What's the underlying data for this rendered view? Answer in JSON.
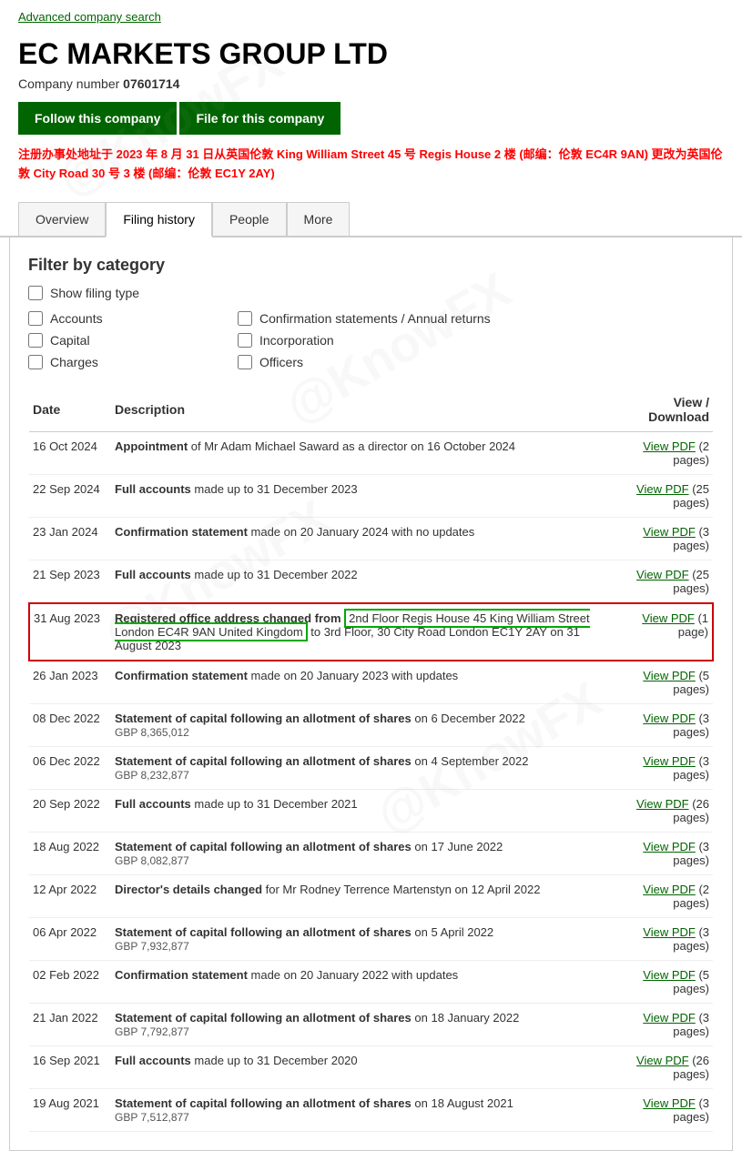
{
  "topLink": {
    "text": "Advanced company search",
    "href": "#"
  },
  "company": {
    "title": "EC MARKETS GROUP LTD",
    "numberLabel": "Company number",
    "number": "07601714"
  },
  "buttons": {
    "follow": "Follow this company",
    "file": "File for this company"
  },
  "notice": "注册办事处地址于 2023 年 8 月 31 日从英国伦敦 King William Street 45 号 Regis House 2 楼 (邮编：伦敦 EC4R 9AN) 更改为英国伦敦 City Road 30 号 3 楼 (邮编：伦敦 EC1Y 2AY)",
  "tabs": [
    {
      "label": "Overview",
      "active": false
    },
    {
      "label": "Filing history",
      "active": true
    },
    {
      "label": "People",
      "active": false
    },
    {
      "label": "More",
      "active": false
    }
  ],
  "filter": {
    "title": "Filter by category",
    "showFilingLabel": "Show filing type",
    "checkboxes": [
      {
        "label": "Accounts",
        "checked": false
      },
      {
        "label": "Confirmation statements / Annual returns",
        "checked": false
      },
      {
        "label": "Capital",
        "checked": false
      },
      {
        "label": "Incorporation",
        "checked": false
      },
      {
        "label": "Charges",
        "checked": false
      },
      {
        "label": "Officers",
        "checked": false
      }
    ]
  },
  "table": {
    "headers": [
      "Date",
      "Description",
      "View / Download"
    ],
    "rows": [
      {
        "date": "16 Oct 2024",
        "descBold": "Appointment",
        "descRest": " of Mr Adam Michael Saward as a director on 16 October 2024",
        "subText": "",
        "viewText": "View PDF",
        "viewSuffix": " (2 pages)",
        "highlighted": false
      },
      {
        "date": "22 Sep 2024",
        "descBold": "Full accounts",
        "descRest": " made up to 31 December 2023",
        "subText": "",
        "viewText": "View PDF",
        "viewSuffix": " (25 pages)",
        "highlighted": false
      },
      {
        "date": "23 Jan 2024",
        "descBold": "Confirmation statement",
        "descRest": " made on 20 January 2024 with no updates",
        "subText": "",
        "viewText": "View PDF",
        "viewSuffix": " (3 pages)",
        "highlighted": false
      },
      {
        "date": "21 Sep 2023",
        "descBold": "Full accounts",
        "descRest": " made up to 31 December 2022",
        "subText": "",
        "viewText": "View PDF",
        "viewSuffix": " (25 pages)",
        "highlighted": false
      },
      {
        "date": "31 Aug 2023",
        "descBold": "Registered office address changed from",
        "descHighlight": " 2nd Floor Regis House 45 King William Street London EC4R 9AN United Kingdom",
        "descRest": " to 3rd Floor, 30 City Road London EC1Y 2AY on 31 August 2023",
        "subText": "",
        "viewText": "View PDF",
        "viewSuffix": " (1 page)",
        "highlighted": true
      },
      {
        "date": "26 Jan 2023",
        "descBold": "Confirmation statement",
        "descRest": " made on 20 January 2023 with updates",
        "subText": "",
        "viewText": "View PDF",
        "viewSuffix": " (5 pages)",
        "highlighted": false
      },
      {
        "date": "08 Dec 2022",
        "descBold": "Statement of capital following an allotment of shares",
        "descRest": " on 6 December 2022",
        "subText": "GBP 8,365,012",
        "viewText": "View PDF",
        "viewSuffix": " (3 pages)",
        "highlighted": false
      },
      {
        "date": "06 Dec 2022",
        "descBold": "Statement of capital following an allotment of shares",
        "descRest": " on 4 September 2022",
        "subText": "GBP 8,232,877",
        "viewText": "View PDF",
        "viewSuffix": " (3 pages)",
        "highlighted": false
      },
      {
        "date": "20 Sep 2022",
        "descBold": "Full accounts",
        "descRest": " made up to 31 December 2021",
        "subText": "",
        "viewText": "View PDF",
        "viewSuffix": " (26 pages)",
        "highlighted": false
      },
      {
        "date": "18 Aug 2022",
        "descBold": "Statement of capital following an allotment of shares",
        "descRest": " on 17 June 2022",
        "subText": "GBP 8,082,877",
        "viewText": "View PDF",
        "viewSuffix": " (3 pages)",
        "highlighted": false
      },
      {
        "date": "12 Apr 2022",
        "descBold": "Director's details changed",
        "descRest": " for Mr Rodney Terrence Martenstyn on 12 April 2022",
        "subText": "",
        "viewText": "View PDF",
        "viewSuffix": " (2 pages)",
        "highlighted": false
      },
      {
        "date": "06 Apr 2022",
        "descBold": "Statement of capital following an allotment of shares",
        "descRest": " on 5 April 2022",
        "subText": "GBP 7,932,877",
        "viewText": "View PDF",
        "viewSuffix": " (3 pages)",
        "highlighted": false
      },
      {
        "date": "02 Feb 2022",
        "descBold": "Confirmation statement",
        "descRest": " made on 20 January 2022 with updates",
        "subText": "",
        "viewText": "View PDF",
        "viewSuffix": " (5 pages)",
        "highlighted": false
      },
      {
        "date": "21 Jan 2022",
        "descBold": "Statement of capital following an allotment of shares",
        "descRest": " on 18 January 2022",
        "subText": "GBP 7,792,877",
        "viewText": "View PDF",
        "viewSuffix": " (3 pages)",
        "highlighted": false
      },
      {
        "date": "16 Sep 2021",
        "descBold": "Full accounts",
        "descRest": " made up to 31 December 2020",
        "subText": "",
        "viewText": "View PDF",
        "viewSuffix": " (26 pages)",
        "highlighted": false
      },
      {
        "date": "19 Aug 2021",
        "descBold": "Statement of capital following an allotment of shares",
        "descRest": " on 18 August 2021",
        "subText": "GBP 7,512,877",
        "viewText": "View PDF",
        "viewSuffix": " (3 pages)",
        "highlighted": false
      }
    ]
  }
}
